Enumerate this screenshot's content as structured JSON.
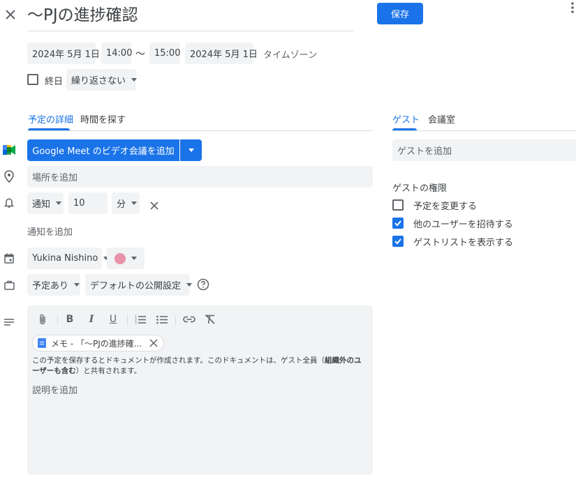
{
  "header": {
    "title": "〜PJの進捗確認",
    "save_label": "保存"
  },
  "datetime": {
    "start_date": "2024年 5月 1日",
    "start_time": "14:00",
    "separator": "〜",
    "end_time": "15:00",
    "end_date": "2024年 5月 1日",
    "timezone_label": "タイムゾーン",
    "all_day_label": "終日",
    "repeat_label": "繰り返さない"
  },
  "tabs": {
    "details": "予定の詳細",
    "find_time": "時間を探す",
    "guests": "ゲスト",
    "rooms": "会議室"
  },
  "meet": {
    "button_label": "Google Meet のビデオ会議を追加"
  },
  "location": {
    "placeholder": "場所を追加"
  },
  "notification": {
    "type": "通知",
    "value": "10",
    "unit": "分",
    "add_label": "通知を追加"
  },
  "calendar": {
    "owner": "Yukina Nishino",
    "color": "#e67c73",
    "availability": "予定あり",
    "visibility": "デフォルトの公開設定"
  },
  "description": {
    "attachment_label": "メモ - 「〜PJの進捗確...",
    "notice_part1": "この予定を保存するとドキュメントが作成されます。このドキュメントは、ゲスト全員（",
    "notice_bold": "組織外のユーザーも含む",
    "notice_part2": "）と共有されます。",
    "placeholder": "説明を追加"
  },
  "guests": {
    "add_placeholder": "ゲストを追加",
    "permissions_title": "ゲストの権限",
    "permissions": [
      {
        "label": "予定を変更する",
        "checked": false
      },
      {
        "label": "他のユーザーを招待する",
        "checked": true
      },
      {
        "label": "ゲストリストを表示する",
        "checked": true
      }
    ]
  },
  "colors": {
    "accent": "#1a73e8",
    "chip_bg": "#f1f3f4",
    "text": "#3c4043"
  }
}
